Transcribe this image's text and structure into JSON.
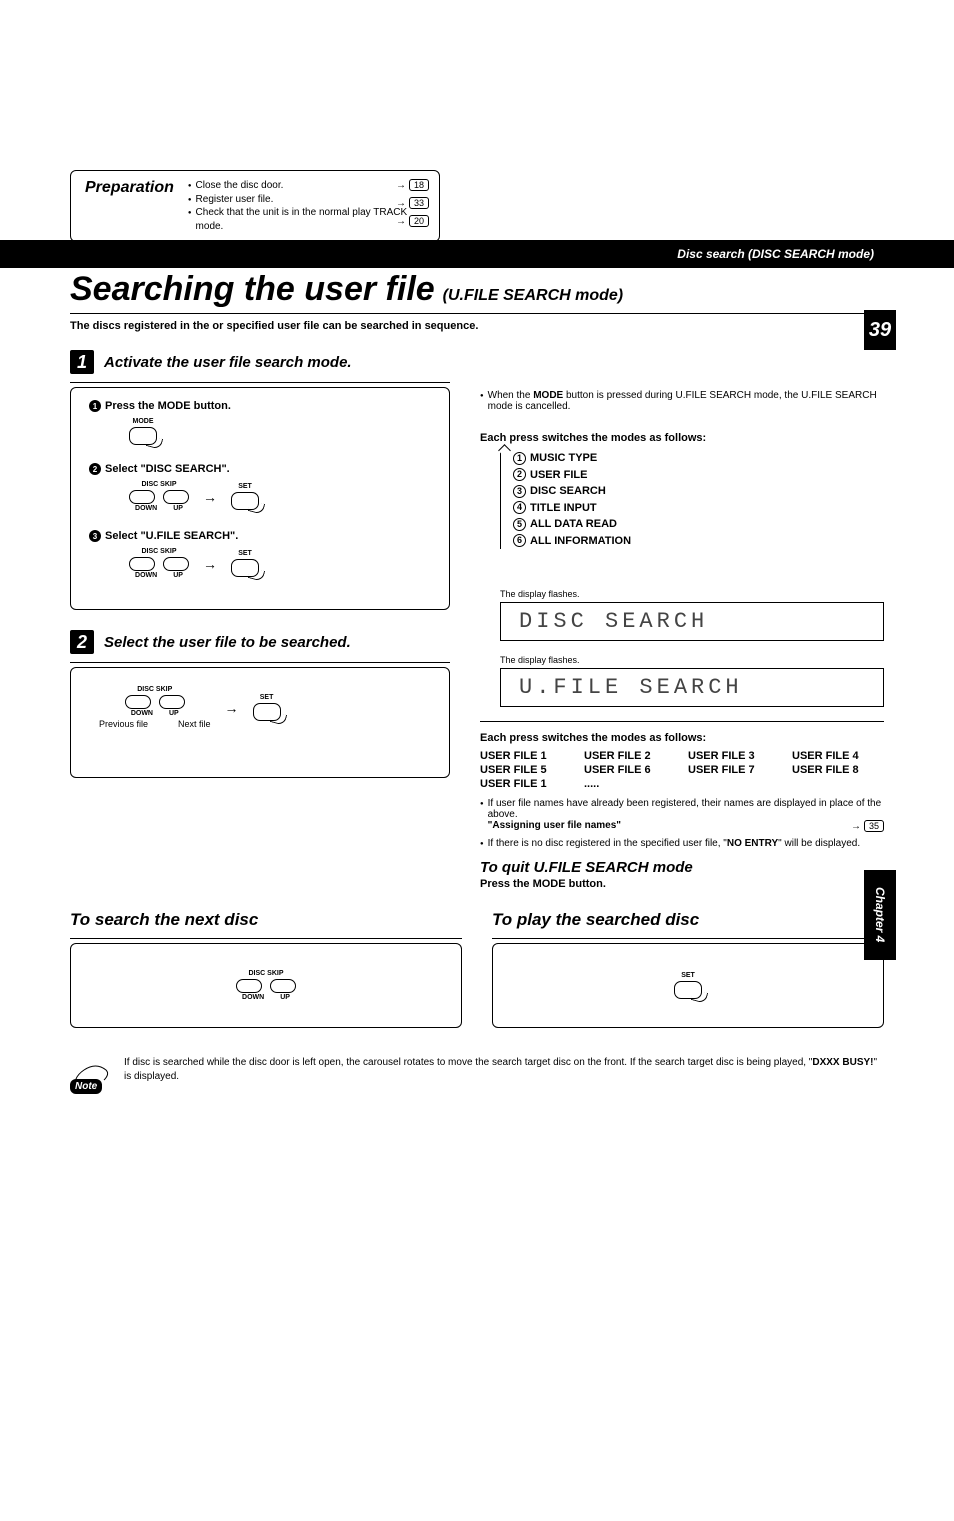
{
  "header": {
    "breadcrumb": "Disc search (DISC SEARCH mode)"
  },
  "page_number": "39",
  "side_label": "Chapter 4",
  "preparation": {
    "title": "Preparation",
    "items": [
      "Close the disc door.",
      "Register user file.",
      "Check that the unit is in the normal play TRACK mode."
    ],
    "refs": [
      "18",
      "33",
      "20"
    ]
  },
  "title": {
    "main": "Searching the user file",
    "sub": "(U.FILE SEARCH  mode)"
  },
  "description": "The discs registered in the or specified user file can be searched in sequence.",
  "step1": {
    "num": "1",
    "title": "Activate the user file search mode.",
    "sub1_num": "1",
    "sub1": "Press the MODE button.",
    "sub2_num": "2",
    "sub2": "Select \"DISC SEARCH\".",
    "sub3_num": "3",
    "sub3": "Select \"U.FILE SEARCH\".",
    "labels": {
      "mode": "MODE",
      "disc_skip": "DISC SKIP",
      "down": "DOWN",
      "up": "UP",
      "set": "SET"
    }
  },
  "step2": {
    "num": "2",
    "title": "Select the user file to be searched.",
    "labels": {
      "disc_skip": "DISC SKIP",
      "down": "DOWN",
      "up": "UP",
      "set": "SET",
      "prev": "Previous file",
      "next": "Next file"
    }
  },
  "right": {
    "note1_pre": "When the ",
    "note1_bold": "MODE",
    "note1_post": " button is pressed during U.FILE SEARCH mode, the U.FILE SEARCH mode is cancelled.",
    "mode_title": "Each press switches the modes as follows:",
    "modes": [
      "MUSIC TYPE",
      "USER FILE",
      "DISC SEARCH",
      "TITLE INPUT",
      "ALL DATA READ",
      "ALL INFORMATION"
    ],
    "flash1": "The display flashes.",
    "display1": "DISC SEARCH",
    "flash2": "The display flashes.",
    "display2": "U.FILE SEARCH",
    "file_title": "Each press switches the modes as follows:",
    "files": [
      "USER FILE 1",
      "USER FILE 2",
      "USER FILE 3",
      "USER FILE 4",
      "USER FILE 5",
      "USER FILE 6",
      "USER FILE 7",
      "USER FILE 8",
      "USER FILE 1",
      "....."
    ],
    "bullet2": "If user file names have already been registered, their names are displayed in place of the above.",
    "bullet2_ref_label": "\"Assigning user file names\"",
    "bullet2_ref": "35",
    "bullet3_pre": "If there is no disc registered in the specified user file, \"",
    "bullet3_bold": "NO ENTRY",
    "bullet3_post": "\" will be displayed.",
    "quit_title": "To quit U.FILE SEARCH mode",
    "quit_instr": "Press the MODE button."
  },
  "bottom_left": {
    "title": "To search the next disc",
    "labels": {
      "disc_skip": "DISC SKIP",
      "down": "DOWN",
      "up": "UP"
    }
  },
  "bottom_right": {
    "title": "To play the searched disc",
    "labels": {
      "set": "SET"
    }
  },
  "note": {
    "badge": "Note",
    "text_pre": "If disc is searched while the disc door is left open, the carousel rotates to move the search target disc on the front. If the search target disc is being played, \"",
    "text_bold": "DXXX BUSY!",
    "text_post": "\" is displayed."
  }
}
